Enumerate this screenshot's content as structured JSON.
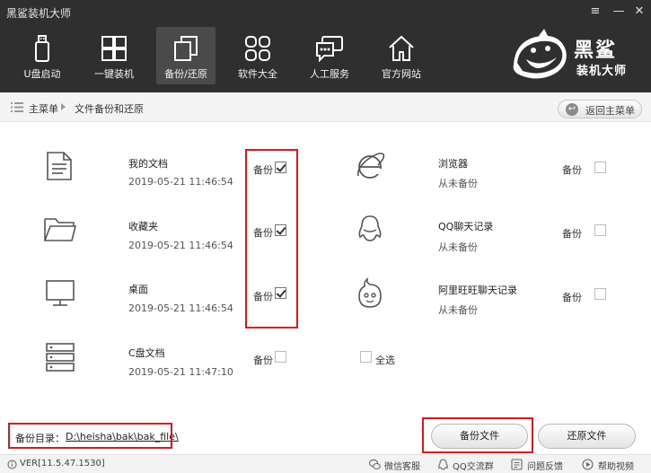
{
  "window": {
    "title": "黑鲨装机大师",
    "controls": [
      "≡",
      "—",
      "✕"
    ]
  },
  "nav": [
    {
      "label": "U盘启动",
      "icon": "usb-drive-icon"
    },
    {
      "label": "一键装机",
      "icon": "windows-icon"
    },
    {
      "label": "备份/还原",
      "icon": "backup-restore-icon",
      "active": true
    },
    {
      "label": "软件大全",
      "icon": "apps-grid-icon"
    },
    {
      "label": "人工服务",
      "icon": "chat-bubble-icon"
    },
    {
      "label": "官方网站",
      "icon": "home-icon"
    }
  ],
  "logo": {
    "line1": "黑鲨",
    "line2": "装机大师"
  },
  "breadcrumb": {
    "home": "主菜单",
    "current": "文件备份和还原",
    "back_button": "返回主菜单"
  },
  "items": [
    {
      "name": "我的文档",
      "date": "2019-05-21 11:46:54",
      "backup_label": "备份",
      "checked": true,
      "icon": "document-icon"
    },
    {
      "name": "收藏夹",
      "date": "2019-05-21 11:46:54",
      "backup_label": "备份",
      "checked": true,
      "icon": "folder-icon"
    },
    {
      "name": "桌面",
      "date": "2019-05-21 11:46:54",
      "backup_label": "备份",
      "checked": true,
      "icon": "monitor-icon"
    },
    {
      "name": "C盘文档",
      "date": "2019-05-21 11:47:10",
      "backup_label": "备份",
      "checked": false,
      "icon": "server-drive-icon"
    },
    {
      "name": "浏览器",
      "date": "从未备份",
      "backup_label": "备份",
      "checked": false,
      "icon": "ie-browser-icon"
    },
    {
      "name": "QQ聊天记录",
      "date": "从未备份",
      "backup_label": "备份",
      "checked": false,
      "icon": "qq-penguin-icon"
    },
    {
      "name": "阿里旺旺聊天记录",
      "date": "从未备份",
      "backup_label": "备份",
      "checked": false,
      "icon": "wangwang-icon"
    }
  ],
  "select_all": {
    "label": "全选",
    "checked": false
  },
  "backup_dir": {
    "label": "备份目录：",
    "path": "D:\\heisha\\bak\\bak_file\\"
  },
  "buttons": {
    "backup": "备份文件",
    "restore": "还原文件"
  },
  "status": {
    "version": "VER[11.5.47.1530]",
    "links": [
      {
        "label": "微信客服",
        "icon": "wechat-icon"
      },
      {
        "label": "QQ交流群",
        "icon": "qq-icon"
      },
      {
        "label": "问题反馈",
        "icon": "feedback-icon"
      },
      {
        "label": "帮助视频",
        "icon": "play-icon"
      }
    ]
  },
  "colors": {
    "topbar": "#2f2f2f",
    "highlight_box": "#e3141b"
  }
}
